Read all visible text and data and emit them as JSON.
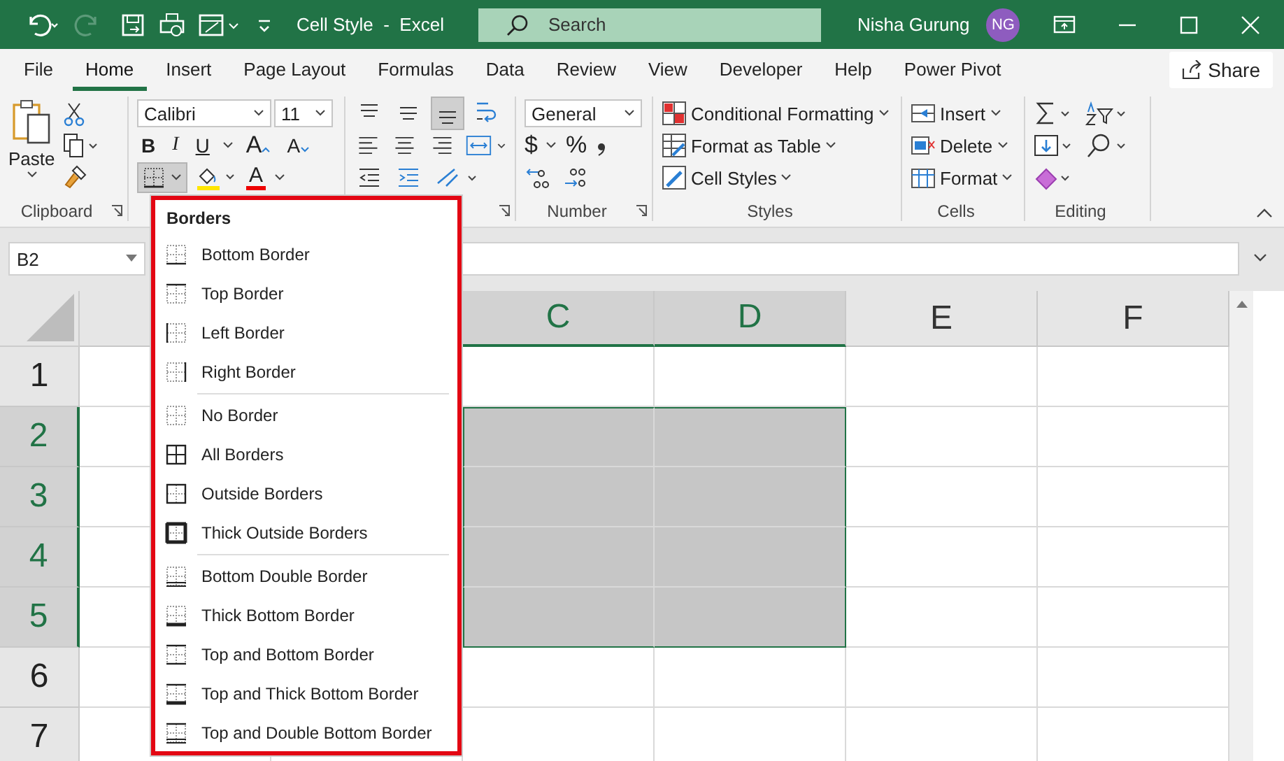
{
  "title_bar": {
    "title": "Cell Style  -  Excel",
    "search": {
      "placeholder": "Search"
    },
    "user": {
      "name": "Nisha Gurung",
      "initials": "NG"
    }
  },
  "tabs": [
    {
      "label": "File",
      "selected": false
    },
    {
      "label": "Home",
      "selected": true
    },
    {
      "label": "Insert",
      "selected": false
    },
    {
      "label": "Page Layout",
      "selected": false
    },
    {
      "label": "Formulas",
      "selected": false
    },
    {
      "label": "Data",
      "selected": false
    },
    {
      "label": "Review",
      "selected": false
    },
    {
      "label": "View",
      "selected": false
    },
    {
      "label": "Developer",
      "selected": false
    },
    {
      "label": "Help",
      "selected": false
    },
    {
      "label": "Power Pivot",
      "selected": false
    }
  ],
  "share_button": {
    "label": "Share"
  },
  "ribbon": {
    "clipboard": {
      "paste": "Paste",
      "label": "Clipboard"
    },
    "font": {
      "name": "Calibri",
      "size": "11",
      "bold": "B",
      "italic": "I",
      "underline": "U",
      "grow": "A",
      "shrink": "A",
      "color_letter": "A"
    },
    "number": {
      "format": "General",
      "currency": "$",
      "percent": "%",
      "label": "Number"
    },
    "styles": {
      "items": [
        "Conditional Formatting",
        "Format as Table",
        "Cell Styles"
      ],
      "label": "Styles"
    },
    "cells": {
      "items": [
        "Insert",
        "Delete",
        "Format"
      ],
      "label": "Cells"
    },
    "editing": {
      "label": "Editing"
    }
  },
  "name_box": "B2",
  "sheet": {
    "columns": [
      {
        "label": "C",
        "selected": true
      },
      {
        "label": "D",
        "selected": true
      },
      {
        "label": "E",
        "selected": false
      },
      {
        "label": "F",
        "selected": false
      }
    ],
    "rows": [
      {
        "label": "1",
        "selected": false
      },
      {
        "label": "2",
        "selected": true
      },
      {
        "label": "3",
        "selected": true
      },
      {
        "label": "4",
        "selected": true
      },
      {
        "label": "5",
        "selected": true
      },
      {
        "label": "6",
        "selected": false
      },
      {
        "label": "7",
        "selected": false
      }
    ]
  },
  "borders_menu": {
    "title": "Borders",
    "groups": [
      [
        {
          "label": "Bottom Border",
          "kind": "bottom"
        },
        {
          "label": "Top Border",
          "kind": "top"
        },
        {
          "label": "Left Border",
          "kind": "left"
        },
        {
          "label": "Right Border",
          "kind": "right"
        }
      ],
      [
        {
          "label": "No Border",
          "kind": "none"
        },
        {
          "label": "All Borders",
          "kind": "all"
        },
        {
          "label": "Outside Borders",
          "kind": "outside"
        },
        {
          "label": "Thick Outside Borders",
          "kind": "thick-outside"
        }
      ],
      [
        {
          "label": "Bottom Double Border",
          "kind": "bottom-double"
        },
        {
          "label": "Thick Bottom Border",
          "kind": "thick-bottom"
        },
        {
          "label": "Top and Bottom Border",
          "kind": "top-bottom"
        },
        {
          "label": "Top and Thick Bottom Border",
          "kind": "top-thick-bottom"
        },
        {
          "label": "Top and Double Bottom Border",
          "kind": "top-double-bottom"
        }
      ]
    ]
  }
}
